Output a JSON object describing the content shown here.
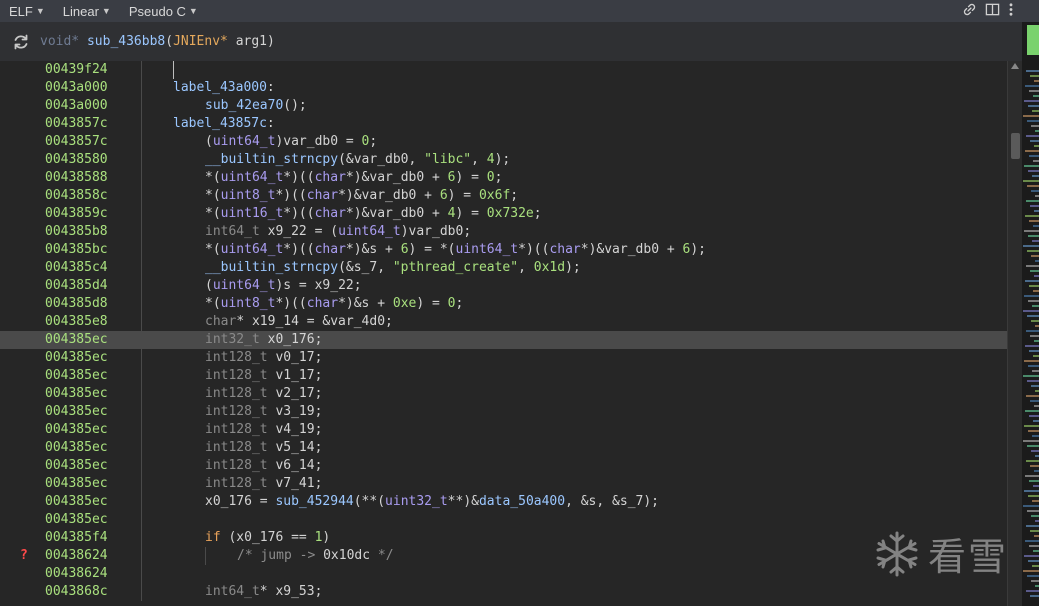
{
  "toolbar": {
    "menus": [
      "ELF",
      "Linear",
      "Pseudo C"
    ]
  },
  "signature": {
    "return_type": "void*",
    "name": "sub_436bb8",
    "param_type": "JNIEnv*",
    "param_name": "arg1"
  },
  "code_lines": [
    {
      "addr": "00439f24",
      "indent": 0,
      "tokens": []
    },
    {
      "addr": "0043a000",
      "indent": 0,
      "tokens": [
        [
          "lb",
          "label_43a000"
        ],
        [
          "p",
          ":"
        ]
      ]
    },
    {
      "addr": "0043a000",
      "indent": 1,
      "tokens": [
        [
          "fn",
          "sub_42ea70"
        ],
        [
          "p",
          "();"
        ]
      ]
    },
    {
      "addr": "0043857c",
      "indent": 0,
      "tokens": [
        [
          "lb",
          "label_43857c"
        ],
        [
          "p",
          ":"
        ]
      ]
    },
    {
      "addr": "0043857c",
      "indent": 1,
      "tokens": [
        [
          "p",
          "("
        ],
        [
          "ty",
          "uint64_t"
        ],
        [
          "p",
          ")var_db0 = "
        ],
        [
          "num",
          "0"
        ],
        [
          "p",
          ";"
        ]
      ]
    },
    {
      "addr": "00438580",
      "indent": 1,
      "tokens": [
        [
          "fn",
          "__builtin_strncpy"
        ],
        [
          "p",
          "(&var_db0, "
        ],
        [
          "str",
          "\"libc\""
        ],
        [
          "p",
          ", "
        ],
        [
          "num",
          "4"
        ],
        [
          "p",
          ");"
        ]
      ]
    },
    {
      "addr": "00438588",
      "indent": 1,
      "tokens": [
        [
          "p",
          "*("
        ],
        [
          "ty",
          "uint64_t"
        ],
        [
          "p",
          "*)(("
        ],
        [
          "ty",
          "char"
        ],
        [
          "p",
          "*)&var_db0 + "
        ],
        [
          "num",
          "6"
        ],
        [
          "p",
          ") = "
        ],
        [
          "num",
          "0"
        ],
        [
          "p",
          ";"
        ]
      ]
    },
    {
      "addr": "0043858c",
      "indent": 1,
      "tokens": [
        [
          "p",
          "*("
        ],
        [
          "ty",
          "uint8_t"
        ],
        [
          "p",
          "*)(("
        ],
        [
          "ty",
          "char"
        ],
        [
          "p",
          "*)&var_db0 + "
        ],
        [
          "num",
          "6"
        ],
        [
          "p",
          ") = "
        ],
        [
          "num",
          "0x6f"
        ],
        [
          "p",
          ";"
        ]
      ]
    },
    {
      "addr": "0043859c",
      "indent": 1,
      "tokens": [
        [
          "p",
          "*("
        ],
        [
          "ty",
          "uint16_t"
        ],
        [
          "p",
          "*)(("
        ],
        [
          "ty",
          "char"
        ],
        [
          "p",
          "*)&var_db0 + "
        ],
        [
          "num",
          "4"
        ],
        [
          "p",
          ") = "
        ],
        [
          "num",
          "0x732e"
        ],
        [
          "p",
          ";"
        ]
      ]
    },
    {
      "addr": "004385b8",
      "indent": 1,
      "tokens": [
        [
          "dim",
          "int64_t"
        ],
        [
          "p",
          " x9_22 = ("
        ],
        [
          "ty",
          "uint64_t"
        ],
        [
          "p",
          ")var_db0;"
        ]
      ]
    },
    {
      "addr": "004385bc",
      "indent": 1,
      "tokens": [
        [
          "p",
          "*("
        ],
        [
          "ty",
          "uint64_t"
        ],
        [
          "p",
          "*)(("
        ],
        [
          "ty",
          "char"
        ],
        [
          "p",
          "*)&s + "
        ],
        [
          "num",
          "6"
        ],
        [
          "p",
          ") = *("
        ],
        [
          "ty",
          "uint64_t"
        ],
        [
          "p",
          "*)(("
        ],
        [
          "ty",
          "char"
        ],
        [
          "p",
          "*)&var_db0 + "
        ],
        [
          "num",
          "6"
        ],
        [
          "p",
          ");"
        ]
      ]
    },
    {
      "addr": "004385c4",
      "indent": 1,
      "tokens": [
        [
          "fn",
          "__builtin_strncpy"
        ],
        [
          "p",
          "(&s_7, "
        ],
        [
          "str",
          "\"pthread_create\""
        ],
        [
          "p",
          ", "
        ],
        [
          "num",
          "0x1d"
        ],
        [
          "p",
          ");"
        ]
      ]
    },
    {
      "addr": "004385d4",
      "indent": 1,
      "tokens": [
        [
          "p",
          "("
        ],
        [
          "ty",
          "uint64_t"
        ],
        [
          "p",
          ")s = x9_22;"
        ]
      ]
    },
    {
      "addr": "004385d8",
      "indent": 1,
      "tokens": [
        [
          "p",
          "*("
        ],
        [
          "ty",
          "uint8_t"
        ],
        [
          "p",
          "*)(("
        ],
        [
          "ty",
          "char"
        ],
        [
          "p",
          "*)&s + "
        ],
        [
          "num",
          "0xe"
        ],
        [
          "p",
          ") = "
        ],
        [
          "num",
          "0"
        ],
        [
          "p",
          ";"
        ]
      ]
    },
    {
      "addr": "004385e8",
      "indent": 1,
      "tokens": [
        [
          "dim",
          "char"
        ],
        [
          "p",
          "* x19_14 = &var_4d0;"
        ]
      ]
    },
    {
      "addr": "004385ec",
      "indent": 1,
      "hl": true,
      "tokens": [
        [
          "dim",
          "int32_t"
        ],
        [
          "p",
          " x0_176;"
        ]
      ]
    },
    {
      "addr": "004385ec",
      "indent": 1,
      "tokens": [
        [
          "dim",
          "int128_t"
        ],
        [
          "p",
          " v0_17;"
        ]
      ]
    },
    {
      "addr": "004385ec",
      "indent": 1,
      "tokens": [
        [
          "dim",
          "int128_t"
        ],
        [
          "p",
          " v1_17;"
        ]
      ]
    },
    {
      "addr": "004385ec",
      "indent": 1,
      "tokens": [
        [
          "dim",
          "int128_t"
        ],
        [
          "p",
          " v2_17;"
        ]
      ]
    },
    {
      "addr": "004385ec",
      "indent": 1,
      "tokens": [
        [
          "dim",
          "int128_t"
        ],
        [
          "p",
          " v3_19;"
        ]
      ]
    },
    {
      "addr": "004385ec",
      "indent": 1,
      "tokens": [
        [
          "dim",
          "int128_t"
        ],
        [
          "p",
          " v4_19;"
        ]
      ]
    },
    {
      "addr": "004385ec",
      "indent": 1,
      "tokens": [
        [
          "dim",
          "int128_t"
        ],
        [
          "p",
          " v5_14;"
        ]
      ]
    },
    {
      "addr": "004385ec",
      "indent": 1,
      "tokens": [
        [
          "dim",
          "int128_t"
        ],
        [
          "p",
          " v6_14;"
        ]
      ]
    },
    {
      "addr": "004385ec",
      "indent": 1,
      "tokens": [
        [
          "dim",
          "int128_t"
        ],
        [
          "p",
          " v7_41;"
        ]
      ]
    },
    {
      "addr": "004385ec",
      "indent": 1,
      "tokens": [
        [
          "p",
          "x0_176 = "
        ],
        [
          "fn",
          "sub_452944"
        ],
        [
          "p",
          "(**("
        ],
        [
          "ty",
          "uint32_t"
        ],
        [
          "p",
          "**)&"
        ],
        [
          "fn",
          "data_50a400"
        ],
        [
          "p",
          ", &s, &s_7);"
        ]
      ]
    },
    {
      "addr": "004385ec",
      "indent": 1,
      "tokens": []
    },
    {
      "addr": "004385f4",
      "indent": 1,
      "tokens": [
        [
          "kw",
          "if"
        ],
        [
          "p",
          " (x0_176 == "
        ],
        [
          "num",
          "1"
        ],
        [
          "p",
          ")"
        ]
      ]
    },
    {
      "addr": "00438624",
      "indent": 2,
      "marker": "?",
      "tokens": [
        [
          "cm",
          "/* jump -> "
        ],
        [
          "p",
          "0x10dc"
        ],
        [
          "cm",
          " */"
        ]
      ]
    },
    {
      "addr": "00438624",
      "indent": 1,
      "tokens": []
    },
    {
      "addr": "0043868c",
      "indent": 1,
      "tokens": [
        [
          "dim",
          "int64_t"
        ],
        [
          "p",
          "* x9_53;"
        ]
      ]
    }
  ],
  "watermark": {
    "text": "看雪"
  },
  "colors": {
    "address": "#a9e07e",
    "type": "#a99cf0",
    "keyword": "#e8a25b",
    "function": "#9bc7ff"
  }
}
